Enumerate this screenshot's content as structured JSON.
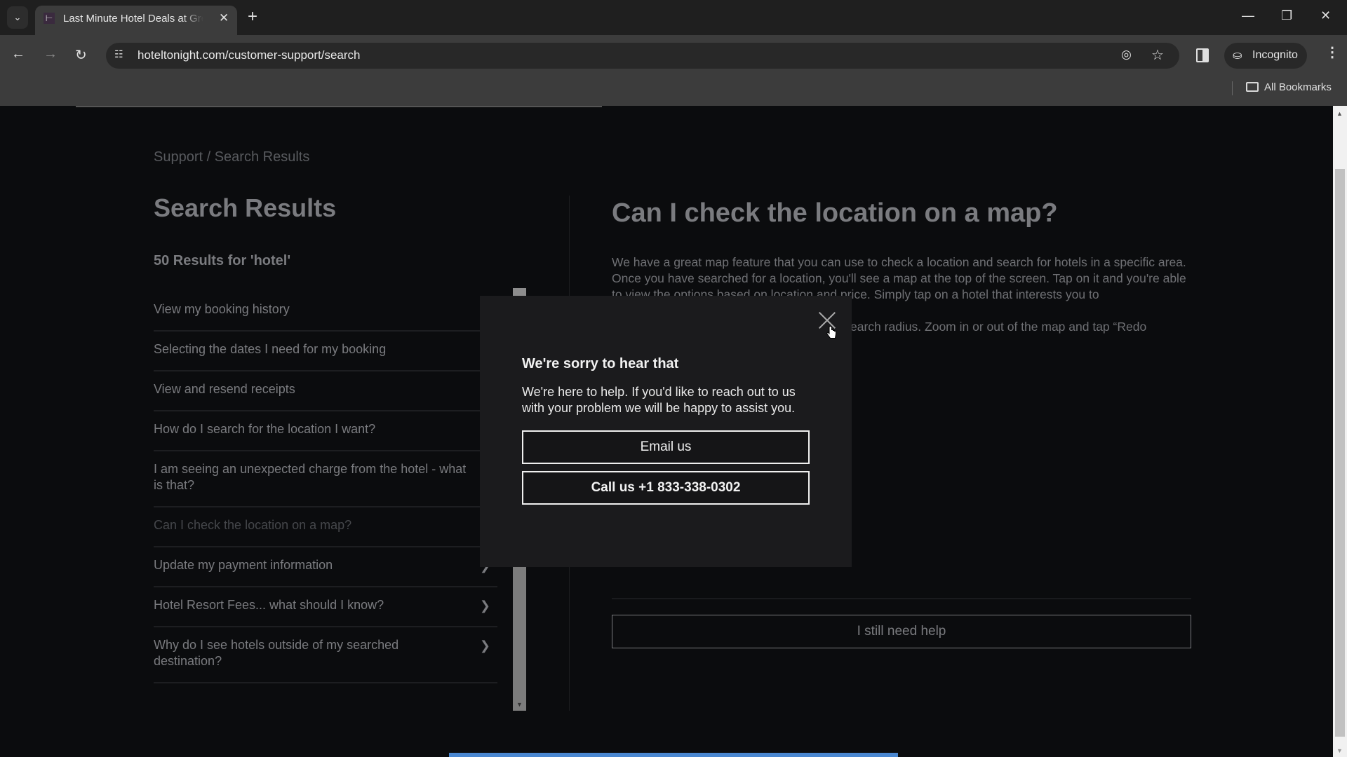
{
  "browser": {
    "tab": {
      "title": "Last Minute Hotel Deals at Great Prices",
      "favicon": "hoteltonight-bed-icon"
    },
    "new_tab_label": "+",
    "url": "hoteltonight.com/customer-support/search",
    "profile_label": "Incognito",
    "bookmarks_label": "All Bookmarks",
    "icons": {
      "tab_dropdown": "chevron-down-icon",
      "back": "arrow-left-icon",
      "forward": "arrow-right-icon",
      "reload": "reload-icon",
      "site_settings": "tune-icon",
      "tracking": "eye-off-icon",
      "bookmark": "star-icon",
      "side_panel": "side-panel-icon",
      "incognito": "incognito-icon",
      "menu": "kebab-menu-icon",
      "minimize": "minimize-icon",
      "restore": "restore-icon",
      "close": "close-icon"
    }
  },
  "page": {
    "breadcrumb": "Support / Search Results",
    "results_title": "Search Results",
    "results_count": "50 Results for 'hotel'",
    "results": [
      {
        "label": "View my booking history",
        "active": false,
        "chevron": false
      },
      {
        "label": "Selecting the dates I need for my booking",
        "active": false,
        "chevron": false
      },
      {
        "label": "View and resend receipts",
        "active": false,
        "chevron": false
      },
      {
        "label": "How do I search for the location I want?",
        "active": false,
        "chevron": false
      },
      {
        "label": "I am seeing an unexpected charge from the hotel - what is that?",
        "active": false,
        "chevron": false
      },
      {
        "label": "Can I check the location on a map?",
        "active": true,
        "chevron": false
      },
      {
        "label": "Update my payment information",
        "active": false,
        "chevron": true
      },
      {
        "label": "Hotel Resort Fees... what should I know?",
        "active": false,
        "chevron": true
      },
      {
        "label": "Why do I see hotels outside of my searched destination?",
        "active": false,
        "chevron": true
      }
    ],
    "chevron_glyph": "❯",
    "article": {
      "title": "Can I check the location on a map?",
      "paragraph_1": "We have a great map feature that you can use to check a location and search for hotels in a specific area. Once you have searched for a location, you'll see a map at the top of the screen. Tap on it and you're able to view the options based on location and price. Simply tap on a hotel that interests you to",
      "paragraph_2": "earch radius. Zoom in or out of the map and tap “Redo"
    },
    "still_need_help_label": "I still need help"
  },
  "modal": {
    "title": "We're sorry to hear that",
    "text": "We're here to help. If you'd like to reach out to us with your problem we will be happy to assist you.",
    "email_label": "Email us",
    "call_label": "Call us +1 833-338-0302"
  }
}
